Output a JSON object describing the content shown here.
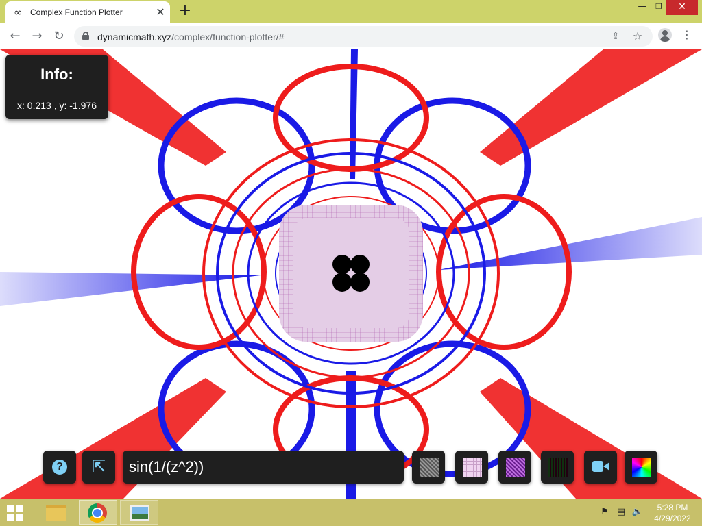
{
  "browser": {
    "tab_title": "Complex Function Plotter",
    "tab_icon": "∞",
    "close_tab_glyph": "✕",
    "new_tab_glyph": "+",
    "url_host": "dynamicmath.xyz",
    "url_path": "/complex/function-plotter/#",
    "window_controls": {
      "minimize": "—",
      "restore": "❐",
      "close": "✕"
    },
    "nav": {
      "back": "←",
      "forward": "→",
      "reload": "↻"
    },
    "icons": {
      "share": "⇪",
      "star": "☆",
      "menu": "⋮"
    }
  },
  "info": {
    "title": "Info:",
    "coords": "x: 0.213 , y: -1.976"
  },
  "controls": {
    "help_glyph": "?",
    "share_glyph": "⇱",
    "function_value": "sin(1/(z^2))",
    "modes": [
      "gray-grid",
      "pink-grid",
      "purple-grid",
      "dark-grid",
      "camera",
      "rainbow"
    ]
  },
  "plot": {
    "colors": {
      "red": "#ee1c1c",
      "blue": "#1a1ae6",
      "center": "#e4cde6",
      "hole": "#000000"
    }
  },
  "taskbar": {
    "time": "5:28 PM",
    "date": "4/29/2022",
    "tray": {
      "flag": "⚑",
      "network": "▤",
      "volume": "🔈"
    }
  }
}
